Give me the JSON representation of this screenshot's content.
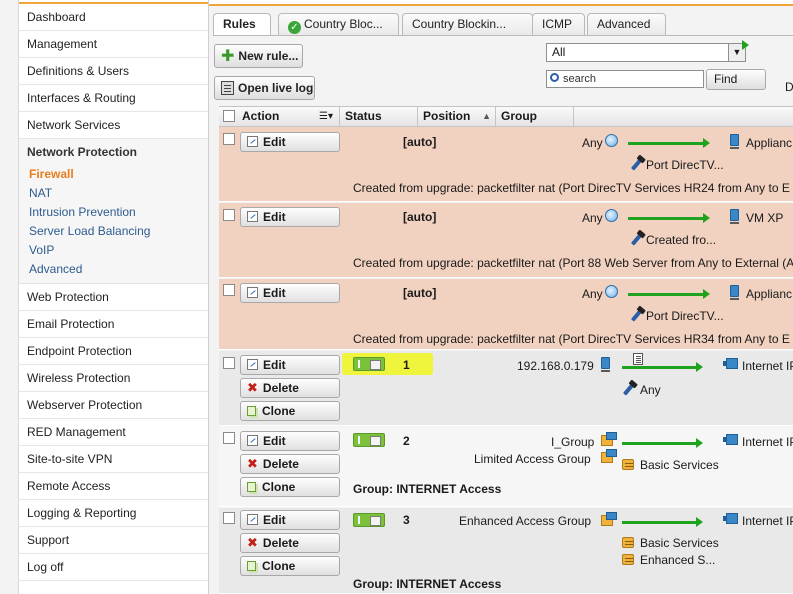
{
  "sidebar": {
    "items_top": [
      "Dashboard",
      "Management",
      "Definitions & Users",
      "Interfaces & Routing",
      "Network Services"
    ],
    "group": {
      "title": "Network Protection",
      "items": [
        "Firewall",
        "NAT",
        "Intrusion Prevention",
        "Server Load Balancing",
        "VoIP",
        "Advanced"
      ],
      "active_index": 0
    },
    "items_bottom": [
      "Web Protection",
      "Email Protection",
      "Endpoint Protection",
      "Wireless Protection",
      "Webserver Protection",
      "RED Management",
      "Site-to-site VPN",
      "Remote Access",
      "Logging & Reporting",
      "Support",
      "Log off"
    ]
  },
  "tabs": [
    "Rules",
    "Country Bloc...",
    "Country Blockin...",
    "ICMP",
    "Advanced"
  ],
  "toolbar": {
    "new_rule": "New rule...",
    "open_live_log": "Open live log",
    "filter_value": "All",
    "search_placeholder": "search",
    "find": "Find",
    "clipped_label": "D"
  },
  "table": {
    "columns": [
      "Action",
      "Status",
      "Position",
      "Group"
    ],
    "rows": [
      {
        "type": "auto",
        "buttons": [
          "Edit"
        ],
        "position_label": "[auto]",
        "source": "Any",
        "destination": "Applianc",
        "service": "Port DirecTV...",
        "comment": "Created from upgrade: packetfilter nat (Port DirecTV Services HR24 from Any to E"
      },
      {
        "type": "auto",
        "buttons": [
          "Edit"
        ],
        "position_label": "[auto]",
        "source": "Any",
        "destination": "VM XP",
        "service": "Created fro...",
        "comment": "Created from upgrade: packetfilter nat (Port 88 Web Server from Any to External (A"
      },
      {
        "type": "auto",
        "buttons": [
          "Edit"
        ],
        "position_label": "[auto]",
        "source": "Any",
        "destination": "Applianc",
        "service": "Port DirecTV...",
        "comment": "Created from upgrade: packetfilter nat (Port DirecTV Services HR34 from Any to E"
      },
      {
        "type": "rule",
        "buttons": [
          "Edit",
          "Delete",
          "Clone"
        ],
        "position": "1",
        "source": "192.168.0.179",
        "destination": "Internet IP",
        "service": "Any",
        "status_enabled": true
      },
      {
        "type": "rule",
        "buttons": [
          "Edit",
          "Delete",
          "Clone"
        ],
        "position": "2",
        "sources": [
          "I_Group",
          "Limited Access Group"
        ],
        "destination": "Internet IP",
        "service": "Basic Services",
        "group_label": "Group: INTERNET Access",
        "status_enabled": true
      },
      {
        "type": "rule",
        "buttons": [
          "Edit",
          "Delete",
          "Clone"
        ],
        "position": "3",
        "source": "Enhanced Access Group",
        "destination": "Internet IP",
        "services": [
          "Basic Services",
          "Enhanced S..."
        ],
        "group_label": "Group: INTERNET Access",
        "status_enabled": true
      }
    ]
  },
  "colors": {
    "accent": "#f0a53a",
    "active_nav": "#e87d1e",
    "auto_row": "#f1d1c0",
    "toggle_on": "#7cc13a",
    "highlight": "#eef53c",
    "arrow": "#1fa31f"
  }
}
